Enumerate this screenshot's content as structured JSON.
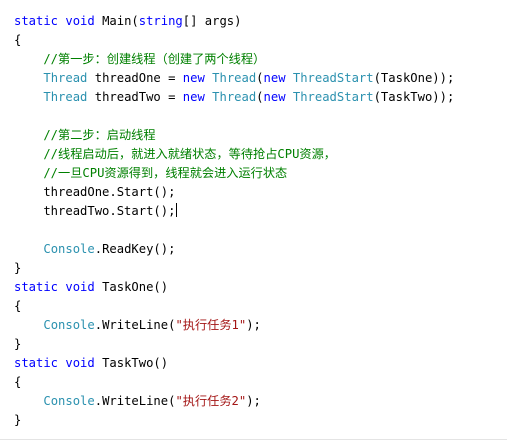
{
  "code_lines": [
    {
      "segments": [
        {
          "text": "static void ",
          "cls": "kw"
        },
        {
          "text": "Main(",
          "cls": "plain"
        },
        {
          "text": "string",
          "cls": "kw"
        },
        {
          "text": "[] args)",
          "cls": "plain"
        }
      ]
    },
    {
      "segments": [
        {
          "text": "{",
          "cls": "plain"
        }
      ]
    },
    {
      "segments": [
        {
          "text": "    //第一步：创建线程（创建了两个线程）",
          "cls": "comment"
        }
      ]
    },
    {
      "segments": [
        {
          "text": "    ",
          "cls": "plain"
        },
        {
          "text": "Thread",
          "cls": "type"
        },
        {
          "text": " threadOne = ",
          "cls": "plain"
        },
        {
          "text": "new",
          "cls": "kw"
        },
        {
          "text": " ",
          "cls": "plain"
        },
        {
          "text": "Thread",
          "cls": "type"
        },
        {
          "text": "(",
          "cls": "plain"
        },
        {
          "text": "new",
          "cls": "kw"
        },
        {
          "text": " ",
          "cls": "plain"
        },
        {
          "text": "ThreadStart",
          "cls": "type"
        },
        {
          "text": "(TaskOne));",
          "cls": "plain"
        }
      ]
    },
    {
      "segments": [
        {
          "text": "    ",
          "cls": "plain"
        },
        {
          "text": "Thread",
          "cls": "type"
        },
        {
          "text": " threadTwo = ",
          "cls": "plain"
        },
        {
          "text": "new",
          "cls": "kw"
        },
        {
          "text": " ",
          "cls": "plain"
        },
        {
          "text": "Thread",
          "cls": "type"
        },
        {
          "text": "(",
          "cls": "plain"
        },
        {
          "text": "new",
          "cls": "kw"
        },
        {
          "text": " ",
          "cls": "plain"
        },
        {
          "text": "ThreadStart",
          "cls": "type"
        },
        {
          "text": "(TaskTwo));",
          "cls": "plain"
        }
      ]
    },
    {
      "segments": [
        {
          "text": "",
          "cls": "plain"
        }
      ]
    },
    {
      "segments": [
        {
          "text": "    //第二步：启动线程",
          "cls": "comment"
        }
      ]
    },
    {
      "segments": [
        {
          "text": "    //线程启动后，就进入就绪状态，等待抢占CPU资源，",
          "cls": "comment"
        }
      ]
    },
    {
      "segments": [
        {
          "text": "    //一旦CPU资源得到，线程就会进入运行状态",
          "cls": "comment"
        }
      ]
    },
    {
      "segments": [
        {
          "text": "    threadOne.Start();",
          "cls": "plain"
        }
      ]
    },
    {
      "segments": [
        {
          "text": "    threadTwo.Start();",
          "cls": "plain"
        }
      ],
      "caret": true
    },
    {
      "segments": [
        {
          "text": "",
          "cls": "plain"
        }
      ]
    },
    {
      "segments": [
        {
          "text": "    ",
          "cls": "plain"
        },
        {
          "text": "Console",
          "cls": "type"
        },
        {
          "text": ".ReadKey();",
          "cls": "plain"
        }
      ]
    },
    {
      "segments": [
        {
          "text": "}",
          "cls": "plain"
        }
      ]
    },
    {
      "segments": [
        {
          "text": "static void ",
          "cls": "kw"
        },
        {
          "text": "TaskOne()",
          "cls": "plain"
        }
      ]
    },
    {
      "segments": [
        {
          "text": "{",
          "cls": "plain"
        }
      ]
    },
    {
      "segments": [
        {
          "text": "    ",
          "cls": "plain"
        },
        {
          "text": "Console",
          "cls": "type"
        },
        {
          "text": ".WriteLine(",
          "cls": "plain"
        },
        {
          "text": "\"执行任务1\"",
          "cls": "str"
        },
        {
          "text": ");",
          "cls": "plain"
        }
      ]
    },
    {
      "segments": [
        {
          "text": "}",
          "cls": "plain"
        }
      ]
    },
    {
      "segments": [
        {
          "text": "static void ",
          "cls": "kw"
        },
        {
          "text": "TaskTwo()",
          "cls": "plain"
        }
      ]
    },
    {
      "segments": [
        {
          "text": "{",
          "cls": "plain"
        }
      ]
    },
    {
      "segments": [
        {
          "text": "    ",
          "cls": "plain"
        },
        {
          "text": "Console",
          "cls": "type"
        },
        {
          "text": ".WriteLine(",
          "cls": "plain"
        },
        {
          "text": "\"执行任务2\"",
          "cls": "str"
        },
        {
          "text": ");",
          "cls": "plain"
        }
      ]
    },
    {
      "segments": [
        {
          "text": "}",
          "cls": "plain"
        }
      ]
    }
  ],
  "colors": {
    "keyword": "#0000ff",
    "type": "#2b91af",
    "comment": "#008000",
    "string": "#a31515",
    "text": "#000000",
    "background": "#ffffff"
  }
}
